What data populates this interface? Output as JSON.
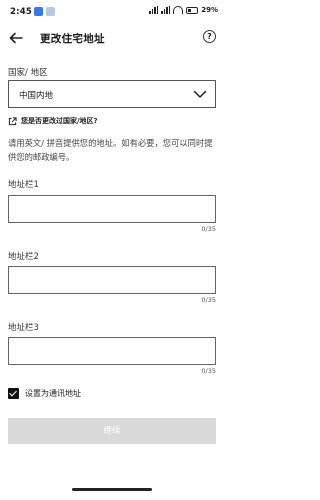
{
  "status_bar": {
    "time": "2:45",
    "battery": "29%",
    "icons": [
      "notification-icon",
      "signal-icon",
      "wifi-icon",
      "battery-icon"
    ]
  },
  "header": {
    "title": "更改住宅地址",
    "back_icon": "arrow-left-icon",
    "help_icon": "question-circle-icon",
    "help_glyph": "?"
  },
  "country": {
    "label": "国家/ 地区",
    "value": "中国内地"
  },
  "change_country_link": "您是否更改过国家/地区?",
  "help_text": "请用英文/ 拼音提供您的地址。如有必要，您可以同时提供您的邮政编号。",
  "address_fields": [
    {
      "label": "地址栏1",
      "value": "",
      "counter": "0/35"
    },
    {
      "label": "地址栏2",
      "value": "",
      "counter": "0/35"
    },
    {
      "label": "地址栏3",
      "value": "",
      "counter": "0/35"
    }
  ],
  "set_as_mailing": {
    "label": "设置为通讯地址",
    "checked": true
  },
  "continue_button": "继续",
  "colors": {
    "button_disabled": "#d9d9d9",
    "notification_blue": "#3478f6"
  }
}
